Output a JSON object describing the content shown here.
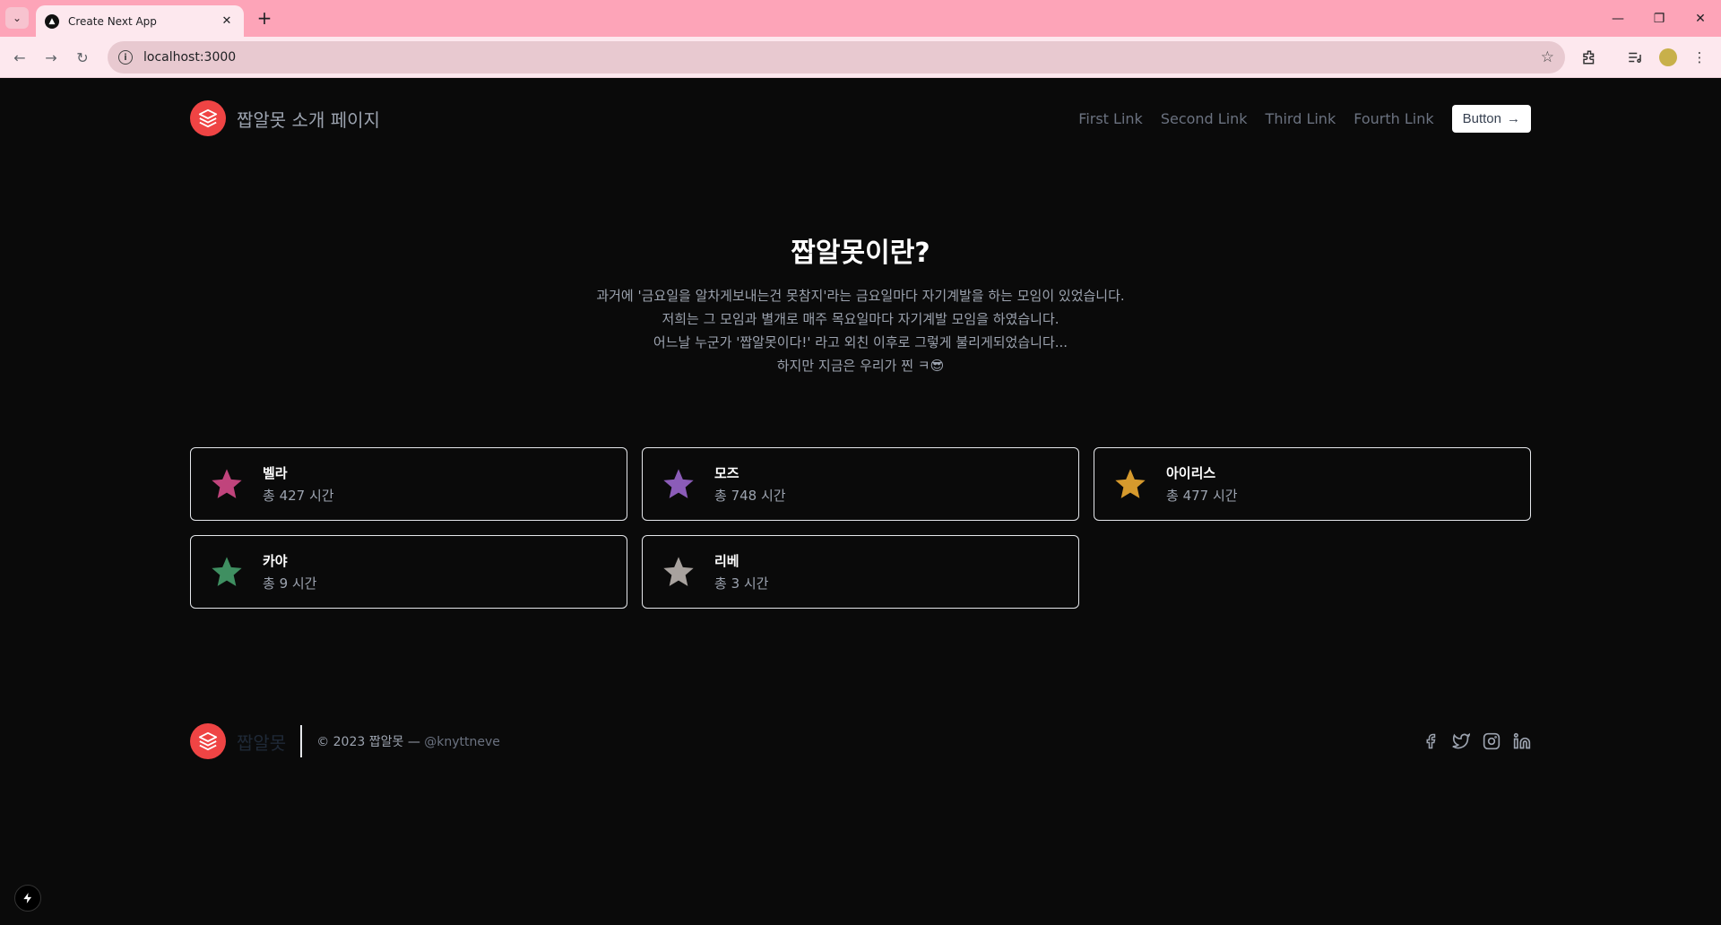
{
  "browser": {
    "tab_title": "Create Next App",
    "url": "localhost:3000"
  },
  "header": {
    "brand": "짭알못 소개 페이지",
    "links": [
      "First Link",
      "Second Link",
      "Third Link",
      "Fourth Link"
    ],
    "button_label": "Button",
    "button_arrow": "→"
  },
  "hero": {
    "title": "짭알못이란?",
    "lines": [
      "과거에 '금요일을 알차게보내는건 못참지'라는 금요일마다 자기계발을 하는 모임이 있었습니다.",
      "저희는 그 모임과 별개로 매주 목요일마다 자기계발 모임을 하였습니다.",
      "어느날 누군가 '짭알못이다!' 라고 외친 이후로 그렇게 불리게되었습니다...",
      "하지만 지금은 우리가 찐 ㅋ😎"
    ]
  },
  "members": [
    {
      "name": "벨라",
      "time": "총 427 시간",
      "color": "#c0447c"
    },
    {
      "name": "모즈",
      "time": "총 748 시간",
      "color": "#8b5cb8"
    },
    {
      "name": "아이리스",
      "time": "총 477 시간",
      "color": "#d69a2d"
    },
    {
      "name": "카야",
      "time": "총 9 시간",
      "color": "#3f8f61"
    },
    {
      "name": "리베",
      "time": "총 3 시간",
      "color": "#a8a29e"
    }
  ],
  "footer": {
    "brand": "짭알못",
    "copyright": "© 2023 짭알못 —",
    "handle": "@knyttneve"
  },
  "colors": {
    "accent": "#ef4444",
    "titlebar": "#fda4b8",
    "background": "#0a0a0a"
  }
}
